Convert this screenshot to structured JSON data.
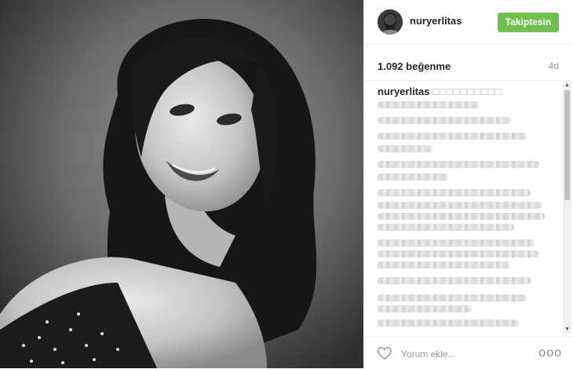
{
  "post": {
    "username": "nuryerlitas",
    "follow_label": "Takiptesin",
    "likes_text": "1.092 beğenme",
    "age_text": "4d",
    "caption_user": "nuryerlitas",
    "caption_obscured": "□□□□□□□□□□",
    "comment_placeholder": "Yorum ekle...",
    "more_glyph": "ooo"
  },
  "colors": {
    "follow_button": "#70c050",
    "text": "#262626",
    "muted": "#999999"
  },
  "icons": {
    "like": "heart-icon",
    "more": "more-options-icon"
  }
}
